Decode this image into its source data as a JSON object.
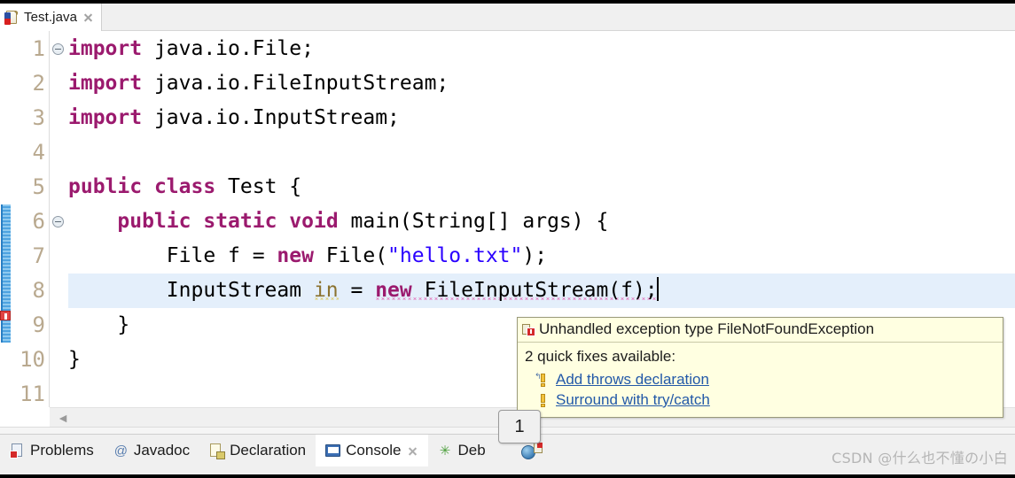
{
  "window": {
    "app": "Eclipse IDE",
    "colors": {
      "keyword": "#9b1a6e",
      "string": "#2a00ff",
      "local_var": "#8b7330",
      "current_line_highlight": "#e4effb",
      "error_squiggle": "#e0208f",
      "warning_squiggle": "#d9b300",
      "tooltip_bg": "#ffffe1",
      "link": "#2359a8",
      "annotation_range": "#4ea3e0"
    }
  },
  "editor_tabs": {
    "active_index": 0,
    "items": [
      {
        "label": "Test.java",
        "icon": "java-file-icon",
        "close_icon": "close-icon",
        "has_error": true
      }
    ]
  },
  "code": {
    "language": "java",
    "current_line": 8,
    "line_numbers": [
      "1",
      "2",
      "3",
      "4",
      "5",
      "6",
      "7",
      "8",
      "9",
      "10",
      "11"
    ],
    "folding_markers": [
      {
        "line": 1,
        "type": "collapse-icon"
      },
      {
        "line": 6,
        "type": "collapse-icon"
      }
    ],
    "lines": [
      {
        "n": "1",
        "text": "import java.io.File;"
      },
      {
        "n": "2",
        "text": "import java.io.FileInputStream;"
      },
      {
        "n": "3",
        "text": "import java.io.InputStream;"
      },
      {
        "n": "4",
        "text": ""
      },
      {
        "n": "5",
        "text": "public class Test {"
      },
      {
        "n": "6",
        "text": "    public static void main(String[] args) {"
      },
      {
        "n": "7",
        "text": "        File f = new File(\"hello.txt\");"
      },
      {
        "n": "8",
        "text": "        InputStream in = new FileInputStream(f);"
      },
      {
        "n": "9",
        "text": "    }"
      },
      {
        "n": "10",
        "text": "}"
      },
      {
        "n": "11",
        "text": ""
      }
    ],
    "tokens": {
      "kw_import": "import",
      "kw_public": "public",
      "kw_class": "class",
      "kw_static": "static",
      "kw_void": "void",
      "kw_new": "new",
      "l1_rest": " java.io.File;",
      "l2_rest": " java.io.FileInputStream;",
      "l3_rest": " java.io.InputStream;",
      "l5_rest": " Test {",
      "l6_indent": "    ",
      "l6_mid": " ",
      "l6_rest": " main(String[] args) {",
      "l7_indent": "        ",
      "l7_a": "File f = ",
      "l7_b": " File(",
      "l7_str": "\"hello.txt\"",
      "l7_c": ");",
      "l8_indent": "        ",
      "l8_type": "InputStream ",
      "l8_var": "in",
      "l8_eq": " = ",
      "l8_err": " FileInputStream(f);",
      "l9": "    }",
      "l10": "}"
    },
    "annotations": {
      "method_range_lines": "6-9",
      "error_marker_line": "8",
      "error_marker_name": "error-marker"
    },
    "scrollbar": {
      "left_arrow": "◄"
    }
  },
  "tooltip": {
    "visible": true,
    "error_icon": "error-icon",
    "title": "Unhandled exception type FileNotFoundException",
    "subtitle": "2 quick fixes available:",
    "fixes": [
      {
        "icon": "quickfix-icon",
        "label": "Add throws declaration"
      },
      {
        "icon": "quickfix-icon",
        "label": "Surround with try/catch"
      }
    ]
  },
  "badge": {
    "value": "1"
  },
  "view_tabs": {
    "active_index": 3,
    "items": [
      {
        "label": "Problems",
        "icon": "problems-icon",
        "active": false,
        "closable": false
      },
      {
        "label": "Javadoc",
        "icon": "javadoc-icon",
        "active": false,
        "closable": false
      },
      {
        "label": "Declaration",
        "icon": "declaration-icon",
        "active": false,
        "closable": false
      },
      {
        "label": "Console",
        "icon": "console-icon",
        "active": true,
        "closable": true
      },
      {
        "label": "Deb",
        "icon": "debug-icon",
        "active": false,
        "closable": false
      }
    ],
    "overflow_icon": "tab-overflow-icon"
  },
  "watermark": {
    "text": "CSDN @什么也不懂の小白"
  }
}
